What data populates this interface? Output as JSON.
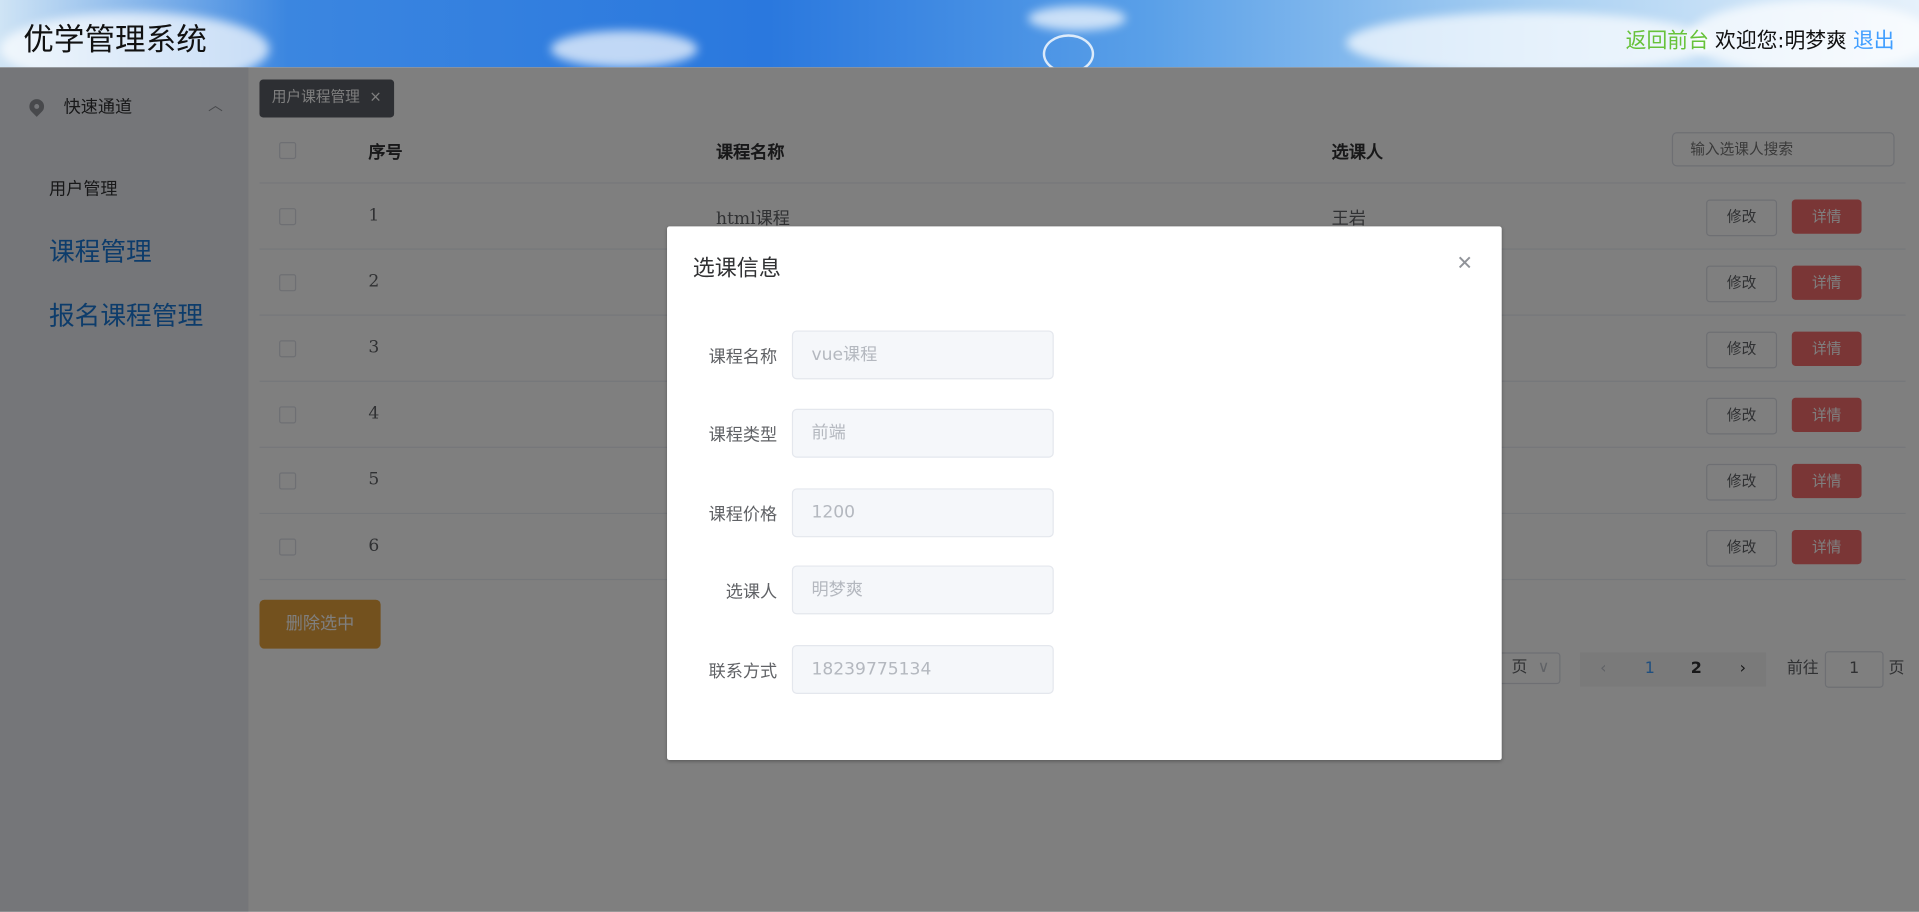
{
  "header": {
    "title": "优学管理系统",
    "back_label": "返回前台",
    "welcome": "欢迎您:明梦爽",
    "logout_label": "退出"
  },
  "sidebar": {
    "group_label": "快速通道",
    "items": [
      {
        "label": "用户管理"
      },
      {
        "label": "课程管理"
      },
      {
        "label": "报名课程管理"
      }
    ]
  },
  "main": {
    "tab_label": "用户课程管理",
    "table": {
      "headers": [
        "序号",
        "课程名称",
        "选课人"
      ],
      "search_placeholder": "输入选课人搜索",
      "rows": [
        {
          "index": "1",
          "course": "html课程",
          "person": "王岩"
        },
        {
          "index": "2",
          "course": "",
          "person": ""
        },
        {
          "index": "3",
          "course": "",
          "person": ""
        },
        {
          "index": "4",
          "course": "",
          "person": ""
        },
        {
          "index": "5",
          "course": "",
          "person": ""
        },
        {
          "index": "6",
          "course": "",
          "person": ""
        }
      ],
      "edit_label": "修改",
      "detail_label": "详情"
    },
    "delete_selected_label": "删除选中",
    "pagination": {
      "page_size_suffix": "页",
      "pages": [
        "1",
        "2"
      ],
      "current": "1",
      "goto_label": "前往",
      "goto_value": "1",
      "page_unit": "页"
    }
  },
  "modal": {
    "title": "选课信息",
    "fields": [
      {
        "label": "课程名称",
        "value": "vue课程"
      },
      {
        "label": "课程类型",
        "value": "前端"
      },
      {
        "label": "课程价格",
        "value": "1200"
      },
      {
        "label": "选课人",
        "value": "明梦爽"
      },
      {
        "label": "联系方式",
        "value": "18239775134"
      }
    ]
  },
  "colors": {
    "accent": "#409eff",
    "danger": "#f56c6c",
    "warning": "#e6a23c",
    "success": "#67c23a",
    "sidebar_link": "#1a78d6"
  }
}
